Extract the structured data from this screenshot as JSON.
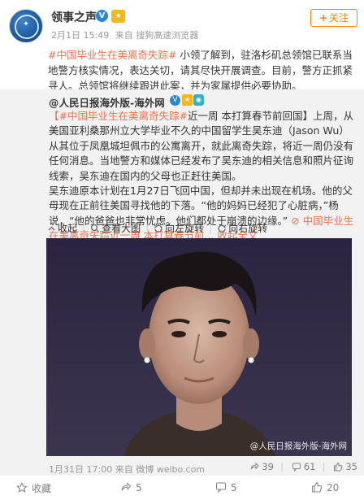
{
  "header": {
    "username": "领事之声",
    "follow_label": "关注",
    "date": "2月1日 15:49",
    "source": "来自 搜狗高速浏览器"
  },
  "post": {
    "hashtag": "#中国毕业生在美离奇失踪#",
    "text": " 小领了解到，驻洛杉矶总领馆已联系当地警方核实情况，表达关切，请其尽快开展调查。目前，警方正抓紧寻人。总领馆将继续跟进此案，并为家属提供必要协助。"
  },
  "repost": {
    "author": "@人民日报海外版-海外网",
    "paragraph1_open": "【",
    "paragraph1_tag": "#中国毕业生在美离奇失踪#",
    "paragraph1_rest": "近一周 本打算春节前回国】上周，从美国亚利桑那州立大学毕业不久的中国留学生吴东迪（Jason Wu）从其位于凤凰城坦佩市的公寓离开，就此离奇失踪，将近一周仍没有任何消息。当地警方和媒体已经发布了吴东迪的相关信息和照片征询线索，吴东迪在国内的父母也正赶往美国。",
    "paragraph2": "吴东迪原本计划在1月27日飞回中国，但却并未出现在机场。他的父母现在正前往美国寻找他的下落。“他的妈妈已经犯了心脏病，”杨说，“他的爸爸也非常忧虑。他们都处于崩溃的边缘。” ",
    "link_text": "中国毕业生在美离奇失踪近一周 本打算春节前...",
    "collapse_label": "收起全文",
    "tools": {
      "collapse": "收起",
      "view_large": "查看大图",
      "rotate_left": "向左旋转",
      "rotate_right": "向右旋转"
    },
    "watermark": "@人民日报海外版-海外网",
    "time": "1月31日 17:00",
    "source": "来自 微博 weibo.com",
    "stats": {
      "forwards": "39",
      "comments": "61",
      "likes": "35"
    }
  },
  "actions": {
    "favorite": "收藏",
    "forward": "5",
    "comment": "5",
    "like": "20"
  },
  "colors": {
    "accent_orange": "#ff8200",
    "hashtag": "#eb7350",
    "verified_blue": "#2b85d8"
  }
}
